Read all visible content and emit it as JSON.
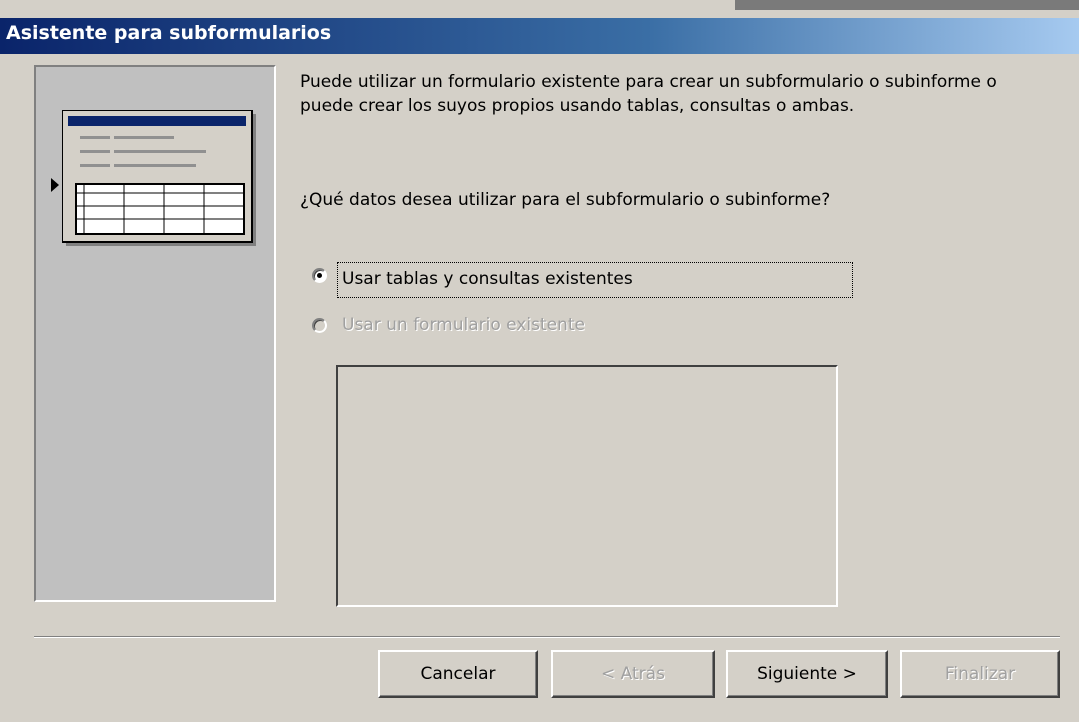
{
  "window": {
    "title": "Asistente para subformularios"
  },
  "content": {
    "description": "Puede utilizar un formulario existente para crear un subformulario o subinforme o puede crear los suyos propios usando tablas, consultas o ambas.",
    "question": "¿Qué datos desea utilizar para el subformulario o subinforme?"
  },
  "options": [
    {
      "label": "Usar tablas y consultas existentes",
      "selected": true,
      "enabled": true
    },
    {
      "label": "Usar un formulario existente",
      "selected": false,
      "enabled": false
    }
  ],
  "buttons": {
    "cancel": "Cancelar",
    "back": "< Atrás",
    "next": "Siguiente >",
    "finish": "Finalizar"
  },
  "colors": {
    "title_start": "#0a246a",
    "title_end": "#a6caf0",
    "face": "#d4d0c8"
  },
  "icons": [
    "wizard-form-illustration",
    "pointer-arrow-icon"
  ]
}
